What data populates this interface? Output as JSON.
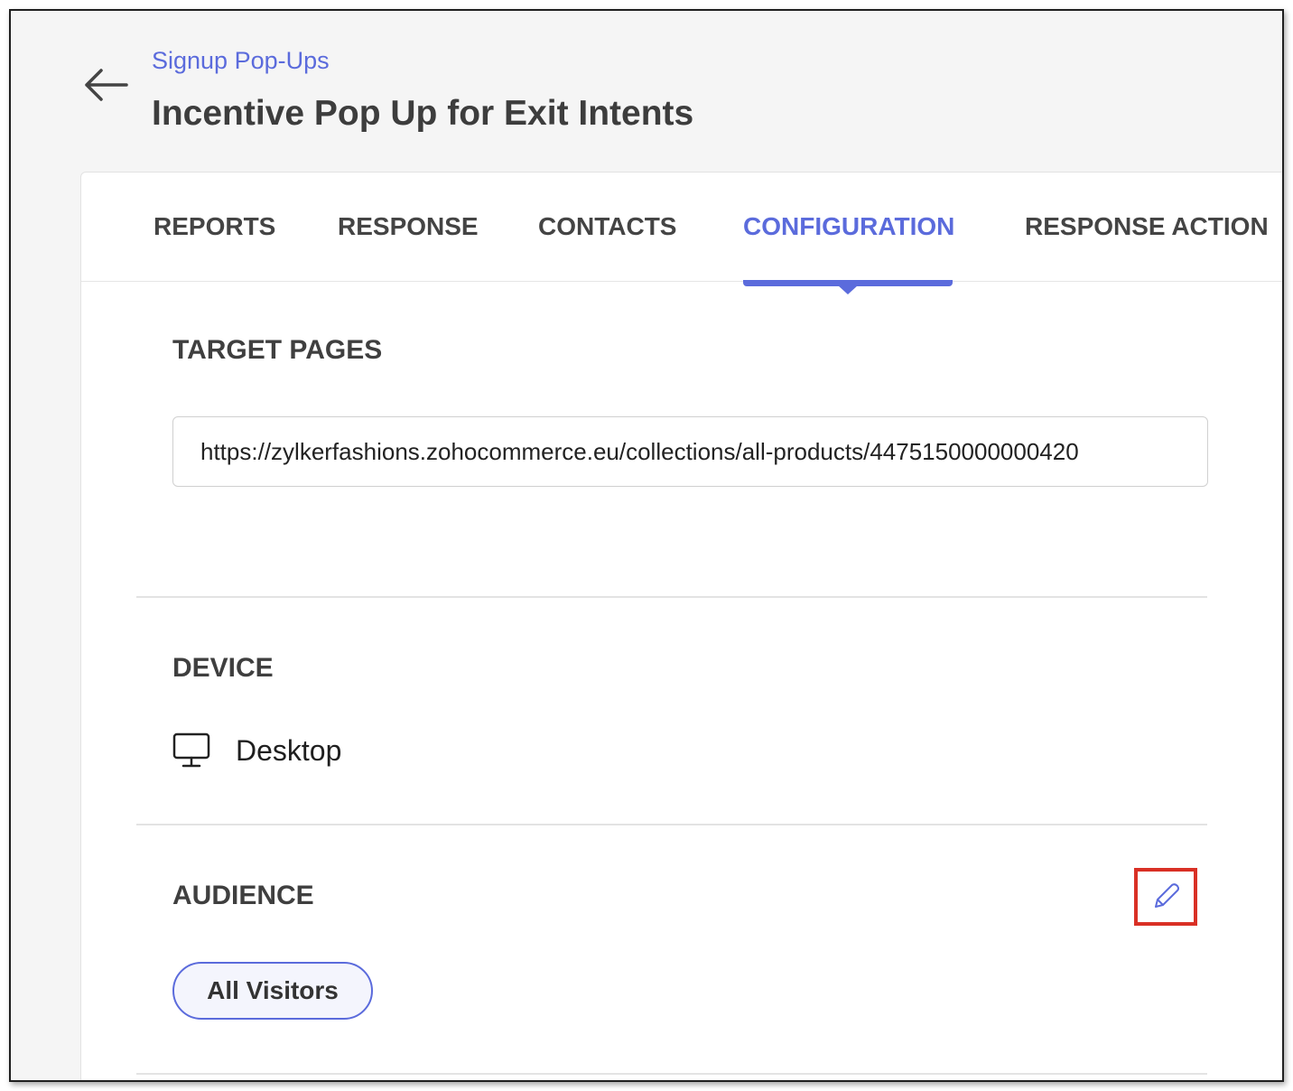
{
  "header": {
    "breadcrumb": "Signup Pop-Ups",
    "title": "Incentive Pop Up for Exit Intents"
  },
  "tabs": [
    {
      "label": "REPORTS",
      "active": false
    },
    {
      "label": "RESPONSE",
      "active": false
    },
    {
      "label": "CONTACTS",
      "active": false
    },
    {
      "label": "CONFIGURATION",
      "active": true
    },
    {
      "label": "RESPONSE ACTION",
      "active": false
    }
  ],
  "sections": {
    "target_pages": {
      "title": "TARGET PAGES",
      "url": "https://zylkerfashions.zohocommerce.eu/collections/all-products/4475150000000420"
    },
    "device": {
      "title": "DEVICE",
      "value": "Desktop",
      "icon": "desktop-icon"
    },
    "audience": {
      "title": "AUDIENCE",
      "value": "All Visitors",
      "edit_icon": "pencil-icon"
    }
  },
  "colors": {
    "accent": "#5b6bdc",
    "highlight": "#d93025",
    "text": "#3f3f3f"
  }
}
